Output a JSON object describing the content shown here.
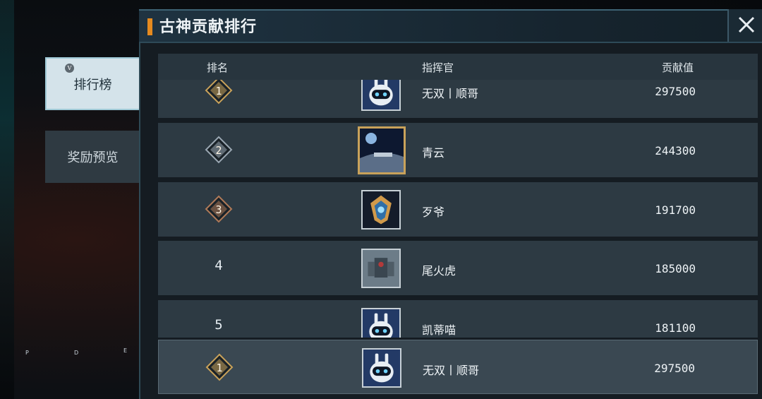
{
  "window": {
    "title": "古神贡献排行"
  },
  "tabs": [
    {
      "label": "排行榜",
      "key": "V",
      "active": true
    },
    {
      "label": "奖励预览",
      "active": false
    }
  ],
  "tab_side_key": "G",
  "hud_letters": [
    "P",
    "D",
    "E"
  ],
  "columns": {
    "rank": "排名",
    "commander": "指挥官",
    "contribution": "贡献值"
  },
  "rows": [
    {
      "rank": "1",
      "name": "无双丨顺哥",
      "score": "297500",
      "badge": "gold",
      "avatar": "robot-avatar"
    },
    {
      "rank": "2",
      "name": "青云",
      "score": "244300",
      "badge": "silver",
      "avatar": "space-avatar"
    },
    {
      "rank": "3",
      "name": "歹爷",
      "score": "191700",
      "badge": "bronze",
      "avatar": "emblem-avatar"
    },
    {
      "rank": "4",
      "name": "尾火虎",
      "score": "185000",
      "badge": "none",
      "avatar": "mech-avatar"
    },
    {
      "rank": "5",
      "name": "凯蒂喵",
      "score": "181100",
      "badge": "none",
      "avatar": "robot-avatar"
    }
  ],
  "my_rank": {
    "rank": "1",
    "name": "无双丨顺哥",
    "score": "297500",
    "badge": "gold",
    "avatar": "robot-avatar"
  },
  "colors": {
    "gold": "#c9a25a",
    "silver": "#9aa7b2",
    "bronze": "#b07a58",
    "accent": "#e58a1f"
  }
}
